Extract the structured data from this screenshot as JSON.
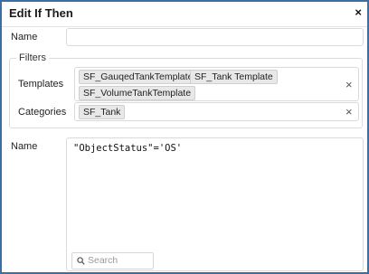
{
  "dialog": {
    "title": "Edit If Then",
    "close_glyph": "×"
  },
  "name_field": {
    "label": "Name",
    "value": ""
  },
  "filters": {
    "legend": "Filters",
    "templates": {
      "label": "Templates",
      "tags": [
        "SF_GauqedTankTemplate",
        "SF_Tank Template",
        "SF_VolumeTankTemplate"
      ],
      "clear_glyph": "×"
    },
    "categories": {
      "label": "Categories",
      "tags": [
        "SF_Tank"
      ],
      "clear_glyph": "×"
    }
  },
  "expression": {
    "label": "Name",
    "value": "\"ObjectStatus\"='OS'",
    "search_placeholder": "Search"
  },
  "colors": {
    "border_accent": "#3b6f9e",
    "tag_background": "#e8e8e8"
  }
}
